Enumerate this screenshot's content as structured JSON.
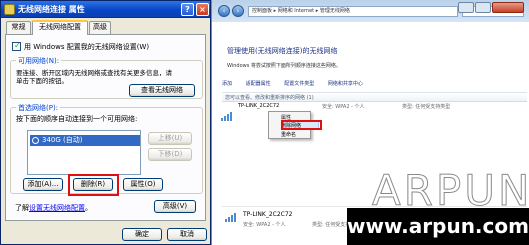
{
  "xp_dialog": {
    "title": "无线网络连接 属性",
    "help_button": "?",
    "close_button": "×",
    "tabs": [
      "常规",
      "无线网络配置",
      "高级"
    ],
    "windows_config_checkbox": "用 Windows 配置我的无线网络设置(W)",
    "available_group": {
      "label": "可用网络(N):",
      "desc_line1": "要连接、断开区域内无线网络或查找有关更多信息，请",
      "desc_line2": "单击下面的按钮。",
      "view_button": "查看无线网络"
    },
    "preferred_group": {
      "label": "首选网络(P):",
      "desc": "按下面的顺序自动连接到一个可用网络:",
      "list_items": [
        "340G (自动)"
      ],
      "up_button": "上移(U)",
      "down_button": "下移(D)",
      "add_button": "添加(A)...",
      "remove_button": "删除(R)",
      "properties_button": "属性(O)"
    },
    "learn_prefix": "了解",
    "learn_link": "设置无线网络配置",
    "learn_suffix": "。",
    "advanced_button": "高级(V)",
    "ok_button": "确定",
    "cancel_button": "取消"
  },
  "win7_window": {
    "address": "控制面板 ▸ 网络和 Internet ▸ 管理无线网络",
    "heading": "管理使用(无线网络连接)的无线网络",
    "subtitle": "Windows 将尝试按照下面所列顺序连接这些网络。",
    "toolbar": [
      "添加",
      "适配器属性",
      "配置文件类型",
      "网络和共享中心"
    ],
    "columns_prefix": "您可以查看、修改和重新排序的网络 (1)",
    "network1": {
      "name": "TP-LINK_2C2C72",
      "security": "安全: WPA2 - 个人",
      "type": "类型: 任何受支持类型"
    },
    "context_menu": [
      "属性",
      "删除网络",
      "重命名"
    ],
    "network2": {
      "name": "TP-LINK_2C2C72",
      "security": "安全: WPA2 - 个人",
      "type": "类型: 任何受支持类型"
    }
  },
  "watermark": {
    "logo_text": "ARPUN",
    "url": "www.arpun.com"
  }
}
